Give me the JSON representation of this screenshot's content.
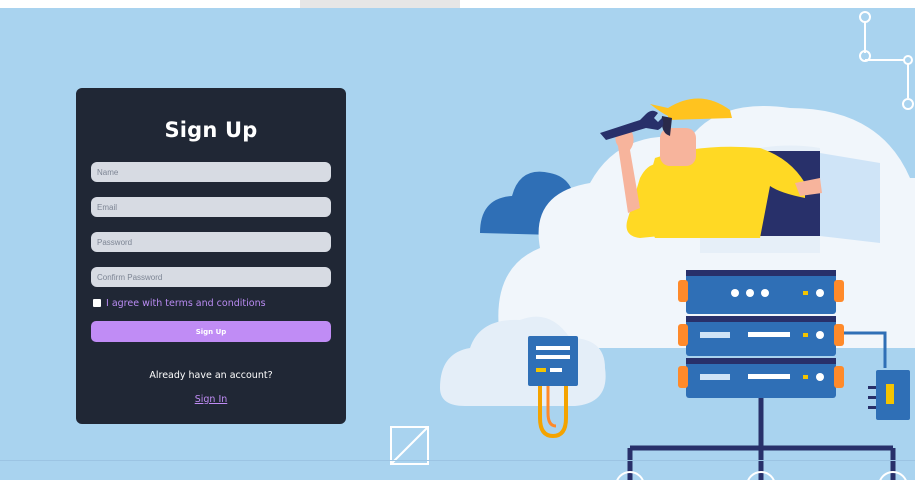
{
  "form": {
    "title": "Sign Up",
    "fields": {
      "name_placeholder": "Name",
      "email_placeholder": "Email",
      "password_placeholder": "Password",
      "confirm_password_placeholder": "Confirm Password"
    },
    "agree_label": "I agree with terms and conditions",
    "agree_checked": false,
    "submit_label": "Sign Up",
    "already_text": "Already have an account?",
    "signin_label": "Sign In"
  },
  "colors": {
    "background": "#a9d3ef",
    "card": "#202735",
    "accent": "#c08cf5",
    "field": "#d7dbe3"
  },
  "icons": [
    "wrench-icon",
    "server-rack-icon",
    "cloud-icon",
    "network-node-icon",
    "crossed-square-icon"
  ]
}
